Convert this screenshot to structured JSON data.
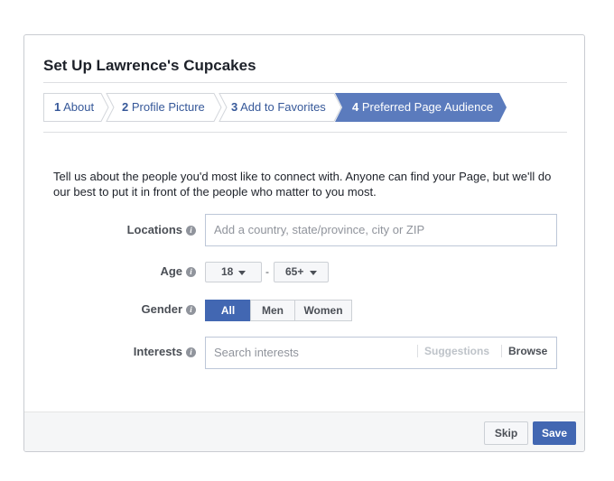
{
  "dialog": {
    "title": "Set Up Lawrence's Cupcakes"
  },
  "steps": [
    {
      "num": "1",
      "label": "About"
    },
    {
      "num": "2",
      "label": "Profile Picture"
    },
    {
      "num": "3",
      "label": "Add to Favorites"
    },
    {
      "num": "4",
      "label": "Preferred Page Audience"
    }
  ],
  "description": "Tell us about the people you'd most like to connect with. Anyone can find your Page, but we'll do our best to put it in front of the people who matter to you most.",
  "form": {
    "locations": {
      "label": "Locations",
      "placeholder": "Add a country, state/province, city or ZIP"
    },
    "age": {
      "label": "Age",
      "min": "18",
      "separator": "-",
      "max": "65+"
    },
    "gender": {
      "label": "Gender",
      "options": [
        "All",
        "Men",
        "Women"
      ],
      "selected": "All"
    },
    "interests": {
      "label": "Interests",
      "placeholder": "Search interests",
      "suggestions": "Suggestions",
      "browse": "Browse"
    }
  },
  "footer": {
    "skip_label": "Skip",
    "save_label": "Save"
  },
  "colors": {
    "accent": "#4267b2",
    "link": "#365899",
    "active_step": "#5b7bbd"
  },
  "icons": {
    "info": "info-icon",
    "caret": "caret-down-icon"
  }
}
